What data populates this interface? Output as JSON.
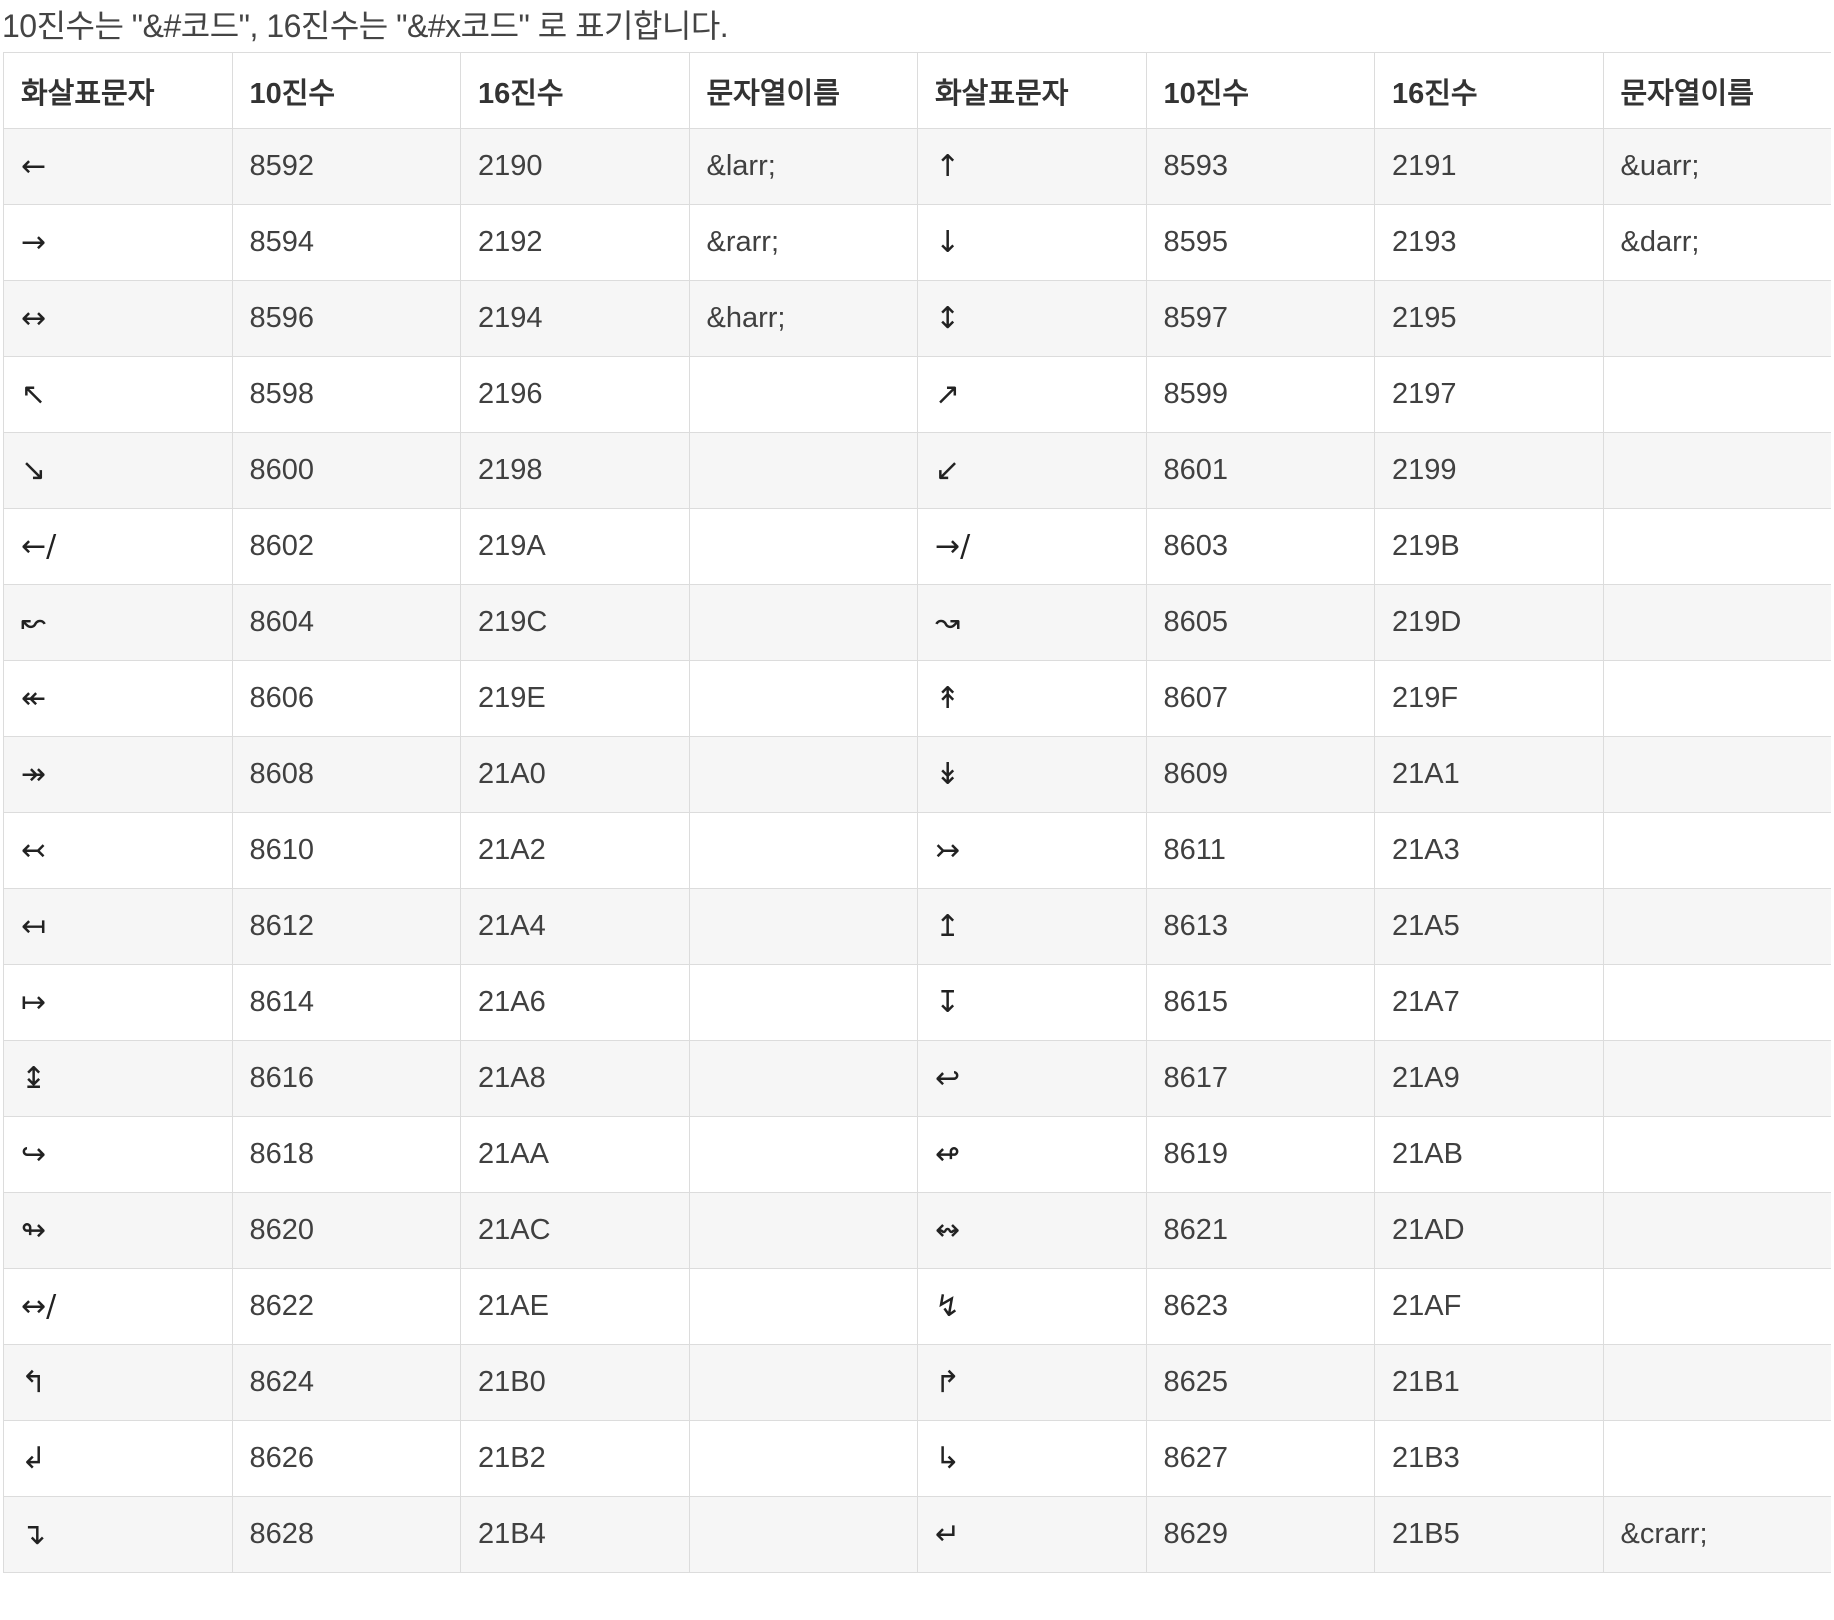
{
  "intro_text": "10진수는 \"&#코드\", 16진수는 \"&#x코드\" 로 표기합니다.",
  "columns": [
    "화살표문자",
    "10진수",
    "16진수",
    "문자열이름",
    "화살표문자",
    "10진수",
    "16진수",
    "문자열이름"
  ],
  "rows": [
    {
      "l_sym": "←",
      "l_dec": "8592",
      "l_hex": "2190",
      "l_name": "&larr;",
      "r_sym": "↑",
      "r_dec": "8593",
      "r_hex": "2191",
      "r_name": "&uarr;"
    },
    {
      "l_sym": "→",
      "l_dec": "8594",
      "l_hex": "2192",
      "l_name": "&rarr;",
      "r_sym": "↓",
      "r_dec": "8595",
      "r_hex": "2193",
      "r_name": "&darr;"
    },
    {
      "l_sym": "↔",
      "l_dec": "8596",
      "l_hex": "2194",
      "l_name": "&harr;",
      "r_sym": "↕",
      "r_dec": "8597",
      "r_hex": "2195",
      "r_name": ""
    },
    {
      "l_sym": "↖",
      "l_dec": "8598",
      "l_hex": "2196",
      "l_name": "",
      "r_sym": "↗",
      "r_dec": "8599",
      "r_hex": "2197",
      "r_name": ""
    },
    {
      "l_sym": "↘",
      "l_dec": "8600",
      "l_hex": "2198",
      "l_name": "",
      "r_sym": "↙",
      "r_dec": "8601",
      "r_hex": "2199",
      "r_name": ""
    },
    {
      "l_sym": "←/",
      "l_dec": "8602",
      "l_hex": "219A",
      "l_name": "",
      "r_sym": "→/",
      "r_dec": "8603",
      "r_hex": "219B",
      "r_name": ""
    },
    {
      "l_sym": "↜",
      "l_dec": "8604",
      "l_hex": "219C",
      "l_name": "",
      "r_sym": "↝",
      "r_dec": "8605",
      "r_hex": "219D",
      "r_name": ""
    },
    {
      "l_sym": "↞",
      "l_dec": "8606",
      "l_hex": "219E",
      "l_name": "",
      "r_sym": "↟",
      "r_dec": "8607",
      "r_hex": "219F",
      "r_name": ""
    },
    {
      "l_sym": "↠",
      "l_dec": "8608",
      "l_hex": "21A0",
      "l_name": "",
      "r_sym": "↡",
      "r_dec": "8609",
      "r_hex": "21A1",
      "r_name": ""
    },
    {
      "l_sym": "↢",
      "l_dec": "8610",
      "l_hex": "21A2",
      "l_name": "",
      "r_sym": "↣",
      "r_dec": "8611",
      "r_hex": "21A3",
      "r_name": ""
    },
    {
      "l_sym": "↤",
      "l_dec": "8612",
      "l_hex": "21A4",
      "l_name": "",
      "r_sym": "↥",
      "r_dec": "8613",
      "r_hex": "21A5",
      "r_name": ""
    },
    {
      "l_sym": "↦",
      "l_dec": "8614",
      "l_hex": "21A6",
      "l_name": "",
      "r_sym": "↧",
      "r_dec": "8615",
      "r_hex": "21A7",
      "r_name": ""
    },
    {
      "l_sym": "↨",
      "l_dec": "8616",
      "l_hex": "21A8",
      "l_name": "",
      "r_sym": "↩",
      "r_dec": "8617",
      "r_hex": "21A9",
      "r_name": ""
    },
    {
      "l_sym": "↪",
      "l_dec": "8618",
      "l_hex": "21AA",
      "l_name": "",
      "r_sym": "↫",
      "r_dec": "8619",
      "r_hex": "21AB",
      "r_name": ""
    },
    {
      "l_sym": "↬",
      "l_dec": "8620",
      "l_hex": "21AC",
      "l_name": "",
      "r_sym": "↭",
      "r_dec": "8621",
      "r_hex": "21AD",
      "r_name": ""
    },
    {
      "l_sym": "↔/",
      "l_dec": "8622",
      "l_hex": "21AE",
      "l_name": "",
      "r_sym": "↯",
      "r_dec": "8623",
      "r_hex": "21AF",
      "r_name": ""
    },
    {
      "l_sym": "↰",
      "l_dec": "8624",
      "l_hex": "21B0",
      "l_name": "",
      "r_sym": "↱",
      "r_dec": "8625",
      "r_hex": "21B1",
      "r_name": ""
    },
    {
      "l_sym": "↲",
      "l_dec": "8626",
      "l_hex": "21B2",
      "l_name": "",
      "r_sym": "↳",
      "r_dec": "8627",
      "r_hex": "21B3",
      "r_name": ""
    },
    {
      "l_sym": "↴",
      "l_dec": "8628",
      "l_hex": "21B4",
      "l_name": "",
      "r_sym": "↵",
      "r_dec": "8629",
      "r_hex": "21B5",
      "r_name": "&crarr;"
    }
  ]
}
